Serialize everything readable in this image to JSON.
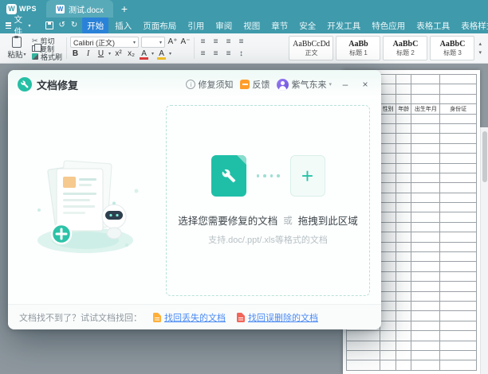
{
  "titlebar": {
    "logo_letter": "W",
    "logo_text": "WPS",
    "doc_tab": "测试.docx",
    "doc_tab_letter": "W",
    "new_tab_label": "+"
  },
  "menubar": {
    "file_label": "文件",
    "tabs": [
      "开始",
      "插入",
      "页面布局",
      "引用",
      "审阅",
      "视图",
      "章节",
      "安全",
      "开发工具",
      "特色应用",
      "表格工具",
      "表格样式"
    ],
    "active_index": 0
  },
  "toolbar": {
    "paste_label": "粘贴",
    "cut_label": "剪切",
    "copy_label": "复制",
    "format_painter_label": "格式刷",
    "font_name": "Calibri (正文)",
    "grow_font": "A⁺",
    "shrink_font": "A⁻",
    "bold": "B",
    "italic": "I",
    "underline": "U",
    "superscript": "x²",
    "subscript": "x₂",
    "font_color": "A",
    "highlight": "A",
    "styles": [
      {
        "sample": "AaBbCcDd",
        "label": "正文"
      },
      {
        "sample": "AaBb",
        "label": "标题 1"
      },
      {
        "sample": "AaBbC",
        "label": "标题 2"
      },
      {
        "sample": "AaBbC",
        "label": "标题 3"
      }
    ]
  },
  "document": {
    "table": {
      "headers": [
        "性别",
        "年龄",
        "出生年月",
        "身份证"
      ],
      "header_row_index": 3,
      "row_count": 30
    }
  },
  "dialog": {
    "title": "文档修复",
    "notice_label": "修复须知",
    "feedback_label": "反馈",
    "user_name": "紫气东来",
    "dropzone": {
      "main_left": "选择您需要修复的文档",
      "or_word": "或",
      "main_right": "拖拽到此区域",
      "hint": "支持.doc/.ppt/.xls等格式的文档"
    },
    "footer": {
      "prompt": "文档找不到了？试试文档找回：",
      "lost_link": "找回丢失的文档",
      "deleted_link": "找回误删除的文档"
    }
  },
  "glyphs": {
    "caret_down": "▾",
    "up_arrow": "▴",
    "down_arrow": "▾",
    "scissors": "✂",
    "undo": "↺",
    "redo": "↻",
    "align": "≡",
    "line_spacing": "↕",
    "plus": "+",
    "minimize": "–",
    "close": "×",
    "info": "i"
  },
  "colors": {
    "titlebar": "#3f9aab",
    "active_menu_tab": "#2a82d8",
    "accent_teal": "#25bfa5",
    "link_blue": "#4a8af4"
  }
}
